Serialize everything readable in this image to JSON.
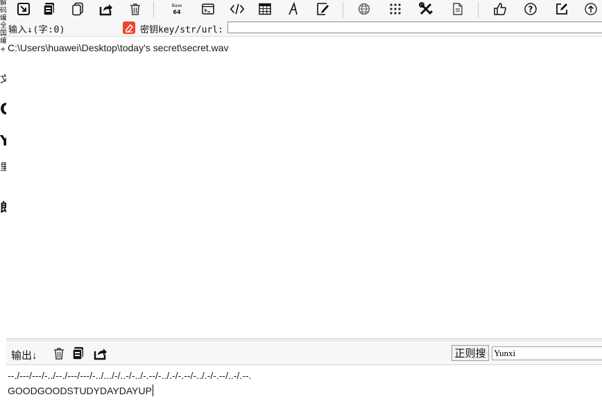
{
  "left_strip": {
    "chars": [
      {
        "text": "解",
        "size": 10
      },
      {
        "text": "码",
        "size": 10
      },
      {
        "text": "编",
        "size": 10
      },
      {
        "text": "全",
        "size": 10
      },
      {
        "text": "国",
        "size": 10
      },
      {
        "text": "编",
        "size": 10
      },
      {
        "text": "+",
        "size": 10
      },
      {
        "text": "文",
        "size": 14
      },
      {
        "text": "C",
        "size": 22
      },
      {
        "text": "Y",
        "size": 20
      },
      {
        "text": "里",
        "size": 14
      },
      {
        "text": "郎",
        "size": 18
      }
    ]
  },
  "toolbar": {
    "icons": [
      "import-icon",
      "copy-icon",
      "copy-outline-icon",
      "share-icon",
      "trash-icon",
      "base64-icon",
      "terminal-icon",
      "code-icon",
      "table-icon",
      "font-icon",
      "highlight-icon",
      "globe-icon",
      "grid-icon",
      "tools-icon",
      "document-icon",
      "thumbs-up-icon",
      "help-icon",
      "edit-icon",
      "upload-icon"
    ],
    "base64_top": "Base",
    "base64_bottom": "64"
  },
  "input_bar": {
    "label": "输入↓(字:0)",
    "key_label": "密钥key/str/url:",
    "key_value": ""
  },
  "input_area": {
    "text": "C:\\Users\\huawei\\Desktop\\today's secret\\secret.wav"
  },
  "output_bar": {
    "label": "输出↓",
    "regex_button": "正则搜",
    "regex_value": "Yunxi"
  },
  "output_area": {
    "line1": "--./---/---/-../--./---/---/-../.../-/..-/-../-.--/-../.-/-.--/-../.-/-.--/..-/.--.",
    "line2": "GOODGOODSTUDYDAYDAYUP"
  }
}
